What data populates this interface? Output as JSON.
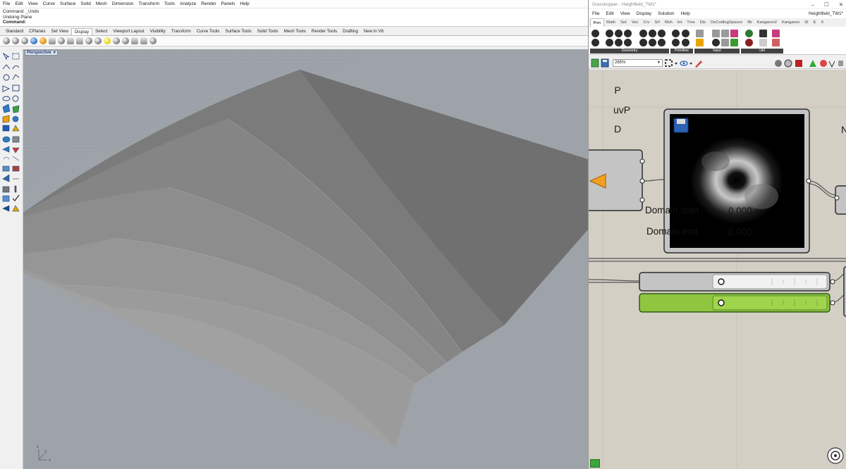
{
  "rhino": {
    "menu": [
      "File",
      "Edit",
      "View",
      "Curve",
      "Surface",
      "Solid",
      "Mesh",
      "Dimension",
      "Transform",
      "Tools",
      "Analyze",
      "Render",
      "Panels",
      "Help"
    ],
    "command_history": [
      "Command: _Undo",
      "Undoing Plane"
    ],
    "command_prompt": "Command:",
    "toolbar_tabs": [
      "Standard",
      "CPlanes",
      "Set View",
      "Display",
      "Select",
      "Viewport Layout",
      "Visibility",
      "Transform",
      "Curve Tools",
      "Surface Tools",
      "Solid Tools",
      "Mesh Tools",
      "Render Tools",
      "Drafting",
      "New in V6"
    ],
    "active_tab": "Display",
    "viewport": {
      "label": "Perspective",
      "label_arrow": "▾",
      "axis_x": "x",
      "axis_y": "y",
      "axis_z": "z"
    }
  },
  "grasshopper": {
    "window_title": "Grasshopper - Heightfield_TW1*",
    "window_buttons": [
      "–",
      "☐",
      "✕"
    ],
    "menu": [
      "File",
      "Edit",
      "View",
      "Display",
      "Solution",
      "Help"
    ],
    "document_name": "Heightfield_TW1*",
    "tabs": [
      "Prm",
      "Math",
      "Set",
      "Vec",
      "Crv",
      "Srf",
      "Msh",
      "Int",
      "Trns",
      "Dis",
      "DeCodingSpaces",
      "Ifb",
      "Kangaroo2",
      "Kangaroo",
      "SI",
      "E",
      "X"
    ],
    "active_tab": "Prm",
    "ribbon_groups": [
      "Geometry",
      "Primitive",
      "Input",
      "Util"
    ],
    "zoom": "265%",
    "components": {
      "ports_left": [
        "P",
        "uvP",
        "D"
      ],
      "image_sampler_port_label": "N",
      "sliders": [
        {
          "label": "Domain start",
          "value": "0.000",
          "state": "default"
        },
        {
          "label": "Domain end",
          "value": "0.000",
          "state": "selected"
        }
      ]
    },
    "colors": {
      "canvas": "#d4cfc5",
      "component_gray": "#c4c4c4",
      "selected_green": "#8ec640",
      "image_bg": "#000000"
    }
  }
}
